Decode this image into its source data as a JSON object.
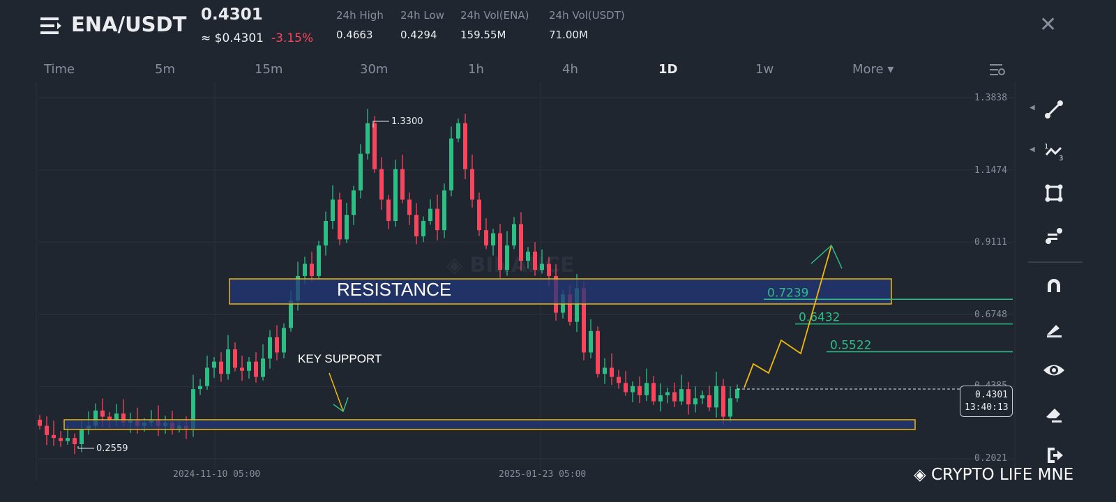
{
  "header": {
    "pair": "ENA/USDT",
    "price": "0.4301",
    "usd_price": "≈ $0.4301",
    "change": "-3.15%",
    "stats": [
      {
        "label": "24h High",
        "value": "0.4663"
      },
      {
        "label": "24h Low",
        "value": "0.4294"
      },
      {
        "label": "24h Vol(ENA)",
        "value": "159.55M"
      },
      {
        "label": "24h Vol(USDT)",
        "value": "71.00M"
      }
    ]
  },
  "timeframes": [
    "Time",
    "5m",
    "15m",
    "30m",
    "1h",
    "4h",
    "1D",
    "1w",
    "More ▾"
  ],
  "active_timeframe": "1D",
  "colors": {
    "up": "#2ebd85",
    "down": "#f6465d",
    "accent": "#f0b90b"
  },
  "chart_data": {
    "type": "candlestick",
    "ylim": [
      0.2021,
      1.3838
    ],
    "y_ticks": [
      "1.3838",
      "1.1474",
      "0.9111",
      "0.6748",
      "0.4385",
      "0.2021"
    ],
    "x_ticks": [
      "2024-11-10 05:00",
      "2025-01-23 05:00"
    ],
    "closes": [
      0.31,
      0.28,
      0.27,
      0.26,
      0.27,
      0.25,
      0.3,
      0.31,
      0.36,
      0.34,
      0.33,
      0.35,
      0.32,
      0.33,
      0.31,
      0.32,
      0.33,
      0.31,
      0.32,
      0.3,
      0.31,
      0.3,
      0.43,
      0.44,
      0.5,
      0.52,
      0.48,
      0.56,
      0.5,
      0.49,
      0.52,
      0.47,
      0.53,
      0.6,
      0.55,
      0.63,
      0.72,
      0.8,
      0.84,
      0.8,
      0.9,
      0.98,
      1.05,
      0.92,
      1.0,
      1.08,
      1.2,
      1.3,
      1.15,
      1.05,
      0.98,
      1.15,
      1.05,
      1.0,
      0.93,
      0.98,
      1.02,
      0.95,
      1.08,
      1.25,
      1.3,
      1.15,
      1.05,
      0.95,
      0.9,
      0.94,
      0.82,
      0.9,
      0.97,
      0.85,
      0.88,
      0.82,
      0.84,
      0.8,
      0.68,
      0.74,
      0.65,
      0.76,
      0.55,
      0.62,
      0.48,
      0.5,
      0.47,
      0.45,
      0.42,
      0.44,
      0.41,
      0.45,
      0.39,
      0.41,
      0.42,
      0.39,
      0.43,
      0.38,
      0.4,
      0.41,
      0.37,
      0.44,
      0.34,
      0.4,
      0.4301
    ],
    "high_label": "1.3300",
    "low_label": "0.2559",
    "last_price": "0.4301",
    "countdown": "13:40:13",
    "annotations": {
      "resistance": "RESISTANCE",
      "support": "KEY SUPPORT",
      "targets": [
        "0.7239",
        "0.6432",
        "0.5522"
      ],
      "target_values": [
        0.7239,
        0.6432,
        0.5522
      ],
      "resistance_range": [
        0.73,
        0.8
      ],
      "support_range": [
        0.27,
        0.3
      ]
    },
    "watermark": "BINANCE"
  },
  "footer_watermark": "CRYPTO LIFE MNE",
  "tools": [
    "trend-line",
    "fib",
    "rectangle",
    "position",
    "magnet",
    "pencil",
    "eye",
    "eraser",
    "exit"
  ]
}
